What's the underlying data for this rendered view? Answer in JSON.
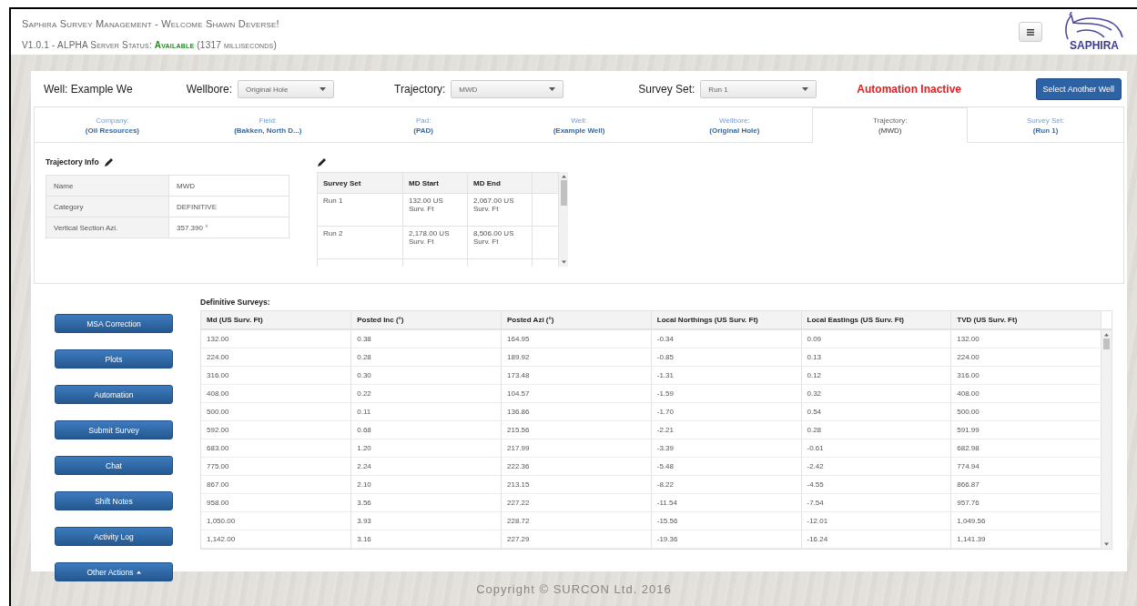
{
  "header": {
    "title": "Saphira Survey Management - Welcome Shawn Deverse!",
    "version": "V1.0.1 - ALPHA Server Status:",
    "status": "Available",
    "status_ok": true,
    "latency": "(1317 milliseconds)",
    "logo_text": "SAPHIRA"
  },
  "toolbar": {
    "well": "Well: Example We",
    "selects": [
      {
        "label": "Wellbore:",
        "value": "Original Hole"
      },
      {
        "label": "Trajectory:",
        "value": "MWD"
      },
      {
        "label": "Survey Set:",
        "value": "Run 1"
      }
    ],
    "automation": "Automation Inactive",
    "automation_active": false,
    "button": "Select Another Well"
  },
  "breadcrumbs": [
    {
      "label": "Company:",
      "value": "(Oil Resources)",
      "selected": false
    },
    {
      "label": "Field:",
      "value": "(Bakken, North D...)",
      "selected": false
    },
    {
      "label": "Pad:",
      "value": "(PAD)",
      "selected": false
    },
    {
      "label": "Well:",
      "value": "(Example Well)",
      "selected": false
    },
    {
      "label": "Wellbore:",
      "value": "(Original Hole)",
      "selected": false
    },
    {
      "label": "Trajectory:",
      "value": "(MWD)",
      "selected": true
    },
    {
      "label": "Survey Set:",
      "value": "(Run 1)",
      "selected": false
    }
  ],
  "trajectory_info": {
    "title": "Trajectory Info",
    "rows": [
      {
        "name": "Name",
        "value": "MWD"
      },
      {
        "name": "Category",
        "value": "DEFINITIVE"
      },
      {
        "name": "Vertical Section Azi.",
        "value": "357.390 °"
      }
    ]
  },
  "survey_sets": {
    "columns": [
      "Survey Set",
      "MD Start",
      "MD End"
    ],
    "rows": [
      [
        "Run 1",
        "132.00 US Surv. Ft",
        "2,067.00 US Surv. Ft"
      ],
      [
        "Run 2",
        "2,178.00 US Surv. Ft",
        "8,506.00 US Surv. Ft"
      ]
    ]
  },
  "actions": [
    "MSA Correction",
    "Plots",
    "Automation",
    "Submit Survey",
    "Chat",
    "Shift Notes",
    "Activity Log",
    "Other Actions"
  ],
  "definitive_surveys": {
    "title": "Definitive Surveys:",
    "columns": [
      "Md (US Surv. Ft)",
      "Posted Inc (°)",
      "Posted Azi (°)",
      "Local Northings (US Surv. Ft)",
      "Local Eastings (US Surv. Ft)",
      "TVD (US Surv. Ft)"
    ],
    "rows": [
      [
        "132.00",
        "0.38",
        "164.95",
        "-0.34",
        "0.09",
        "132.00"
      ],
      [
        "224.00",
        "0.28",
        "189.92",
        "-0.85",
        "0.13",
        "224.00"
      ],
      [
        "316.00",
        "0.30",
        "173.48",
        "-1.31",
        "0.12",
        "316.00"
      ],
      [
        "408.00",
        "0.22",
        "104.57",
        "-1.59",
        "0.32",
        "408.00"
      ],
      [
        "500.00",
        "0.11",
        "136.86",
        "-1.70",
        "0.54",
        "500.00"
      ],
      [
        "592.00",
        "0.68",
        "215.56",
        "-2.21",
        "0.28",
        "591.99"
      ],
      [
        "683.00",
        "1.20",
        "217.99",
        "-3.39",
        "-0.61",
        "682.98"
      ],
      [
        "775.00",
        "2.24",
        "222.36",
        "-5.48",
        "-2.42",
        "774.94"
      ],
      [
        "867.00",
        "2.10",
        "213.15",
        "-8.22",
        "-4.55",
        "866.87"
      ],
      [
        "958.00",
        "3.56",
        "227.22",
        "-11.54",
        "-7.54",
        "957.76"
      ],
      [
        "1,050.00",
        "3.93",
        "228.72",
        "-15.56",
        "-12.01",
        "1,049.56"
      ],
      [
        "1,142.00",
        "3.16",
        "227.29",
        "-19.36",
        "-16.24",
        "1,141.39"
      ]
    ]
  },
  "footer": "Copyright © SURCON Ltd. 2016"
}
